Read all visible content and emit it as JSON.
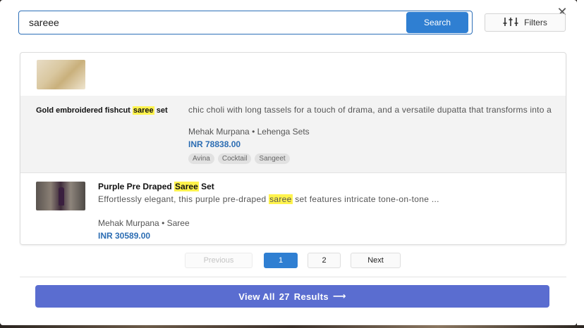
{
  "search": {
    "value": "sareee",
    "button_label": "Search"
  },
  "filters": {
    "label": "Filters",
    "icon": "sliders-icon"
  },
  "close": {
    "label": "✕",
    "icon": "close-icon"
  },
  "results": [
    {
      "title_before": "Gold embroidered fishcut ",
      "title_highlight": "saree",
      "title_after": " set",
      "description": "chic choli with long tassels for a touch of drama, and a versatile dupatta that transforms into a",
      "designer": "Mehak Murpana",
      "category": "Lehenga Sets",
      "price": "INR 78838.00",
      "tags": [
        "Avina",
        "Cocktail",
        "Sangeet"
      ]
    },
    {
      "title_before": "Purple Pre Draped ",
      "title_highlight": "Saree",
      "title_after": " Set",
      "description_before": "Effortlessly elegant, this purple pre-draped ",
      "description_highlight": "saree",
      "description_after": " set features intricate tone-on-tone ...",
      "designer": "Mehak Murpana",
      "category": "Saree",
      "price": "INR 30589.00"
    }
  ],
  "meta_separator": "•",
  "pagination": {
    "previous": "Previous",
    "pages": [
      "1",
      "2"
    ],
    "current": "1",
    "next": "Next"
  },
  "view_all": {
    "prefix": "View All",
    "count": "27",
    "suffix": "Results",
    "arrow": "⟶"
  },
  "colors": {
    "primary": "#2f7fd2",
    "view_all_bg": "#5a6dd0",
    "price": "#2c6db3",
    "highlight": "#fff34d"
  }
}
